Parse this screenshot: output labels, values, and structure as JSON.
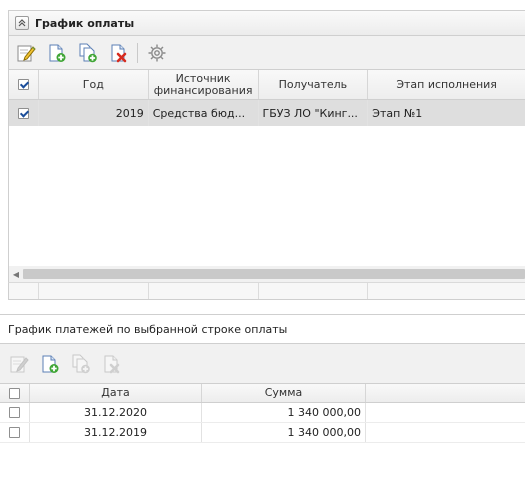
{
  "payment_schedule": {
    "title": "График оплаты",
    "toolbar": [
      {
        "name": "edit-icon",
        "enabled": true
      },
      {
        "name": "add-icon",
        "enabled": true
      },
      {
        "name": "copy-icon",
        "enabled": true
      },
      {
        "name": "delete-icon",
        "enabled": true
      },
      {
        "name": "settings-icon",
        "enabled": true
      }
    ],
    "columns": [
      "Год",
      "Источник финансирования",
      "Получатель",
      "Этап исполнения"
    ],
    "rows": [
      {
        "checked": true,
        "year": "2019",
        "source": "Средства бюд...",
        "recipient": "ГБУЗ ЛО \"Кинг...",
        "stage": "Этап №1"
      }
    ],
    "header_checked": true
  },
  "payments_by_row": {
    "title": "График платежей по выбранной строке оплаты",
    "toolbar": [
      {
        "name": "edit-icon",
        "enabled": false
      },
      {
        "name": "add-icon",
        "enabled": true
      },
      {
        "name": "copy-icon",
        "enabled": false
      },
      {
        "name": "delete-icon",
        "enabled": false
      }
    ],
    "columns": [
      "Дата",
      "Сумма"
    ],
    "rows": [
      {
        "checked": false,
        "date": "31.12.2020",
        "amount": "1 340 000,00"
      },
      {
        "checked": false,
        "date": "31.12.2019",
        "amount": "1 340 000,00"
      }
    ]
  },
  "colors": {
    "selected_row": "#dedede",
    "green_plus": "#3fa535",
    "red_x": "#d62b1f"
  }
}
